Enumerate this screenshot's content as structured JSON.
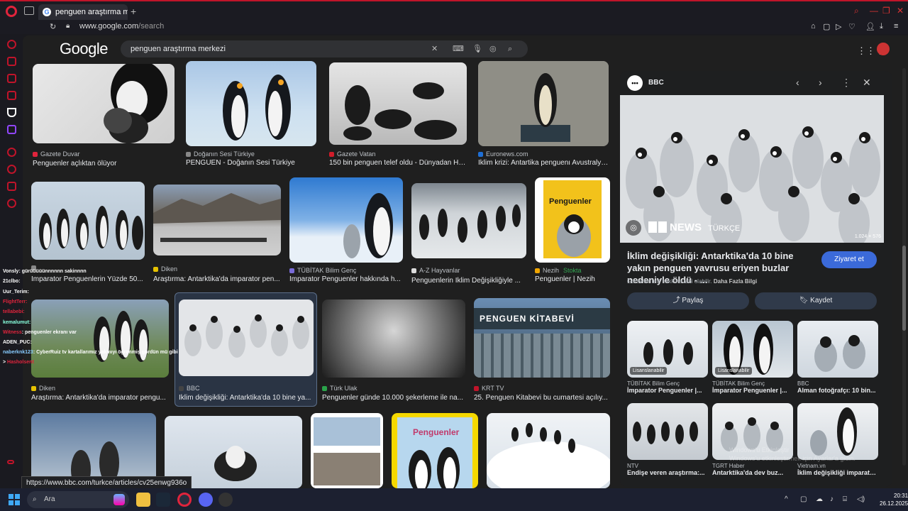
{
  "browser": {
    "tab_title": "penguen araştırma merkez",
    "url_host": "www.google.com",
    "url_path": "/search",
    "status_url": "https://www.bbc.com/turkce/articles/cv25enwg936o"
  },
  "google": {
    "logo": "Google",
    "query": "penguen araştırma merkezi"
  },
  "results": [
    {
      "source": "Gazete Duvar",
      "title": "Penguenler açlıktan ölüyor",
      "color": "#e0243c"
    },
    {
      "source": "Doğanın Sesi Türkiye",
      "title": "PENGUEN - Doğanın Sesi Türkiye",
      "color": "#888888"
    },
    {
      "source": "Gazete Vatan",
      "title": "150 bin penguen telef oldu - Dünyadan Ha...",
      "color": "#d01c2a"
    },
    {
      "source": "Euronews.com",
      "title": "İklim krizi: Antartika penguenı Avustralya...",
      "color": "#1e6fd6"
    },
    {
      "source": "",
      "title": "İmparator Penguenlerin Yüzde 50...",
      "color": "#888888"
    },
    {
      "source": "Diken",
      "title": "Araştırma: Antarktika'da imparator pen...",
      "color": "#e6c200"
    },
    {
      "source": "TÜBİTAK Bilim Genç",
      "title": "İmparator Penguenler hakkında h...",
      "color": "#7a6cd9"
    },
    {
      "source": "A-Z Hayvanlar",
      "title": "Penguenlerin İklim Değişikliğiyle ...",
      "color": "#dddddd"
    },
    {
      "source": "Nezih",
      "stock": "Stokta",
      "title": "Penguenler | Nezih",
      "color": "#f0a500"
    },
    {
      "source": "Diken",
      "title": "Araştırma: Antarktika'da imparator pengu...",
      "color": "#e6c200"
    },
    {
      "source": "BBC",
      "title": "İklim değişikliği: Antarktika'da 10 bine ya...",
      "color": "#444444"
    },
    {
      "source": "Türk Ulak",
      "title": "Penguenler günde 10.000 şekerleme ile na...",
      "color": "#2aa34a"
    },
    {
      "source": "KRT TV",
      "title": "25. Penguen Kitabevi bu cumartesi açılıy...",
      "color": "#c0142a"
    }
  ],
  "bookcovers": {
    "book1": "Penguenler",
    "book2": "Penguenler",
    "store": "PENGUEN KİTABEVİ"
  },
  "panel": {
    "source": "BBC",
    "source_icon": "•••",
    "watermark": "NEWS",
    "watermark_lang": "TÜRKÇE",
    "dimensions": "1.024 × 576",
    "title": "İklim değişikliği: Antarktika'da 10 bine yakın penguen yavrusu eriyen buzlar nedeniyle öldü - ...",
    "visit": "Ziyaret et",
    "note": "Görseller telif hakkına tabi olabilir.",
    "more": "Daha Fazla Bilgi",
    "share": "Paylaş",
    "save": "Kaydet",
    "related": [
      {
        "source": "TÜBİTAK Bilim Genç",
        "title": "İmparator Penguenler |...",
        "badge": "Lisanslanabilir"
      },
      {
        "source": "TÜBİTAK Bilim Genç",
        "title": "İmparator Penguenler |...",
        "badge": "Lisanslanabilir"
      },
      {
        "source": "BBC",
        "title": "Alman fotoğrafçı: 10 bin...",
        "badge": ""
      },
      {
        "source": "NTV",
        "title": "Endişe veren araştırma:...",
        "badge": ""
      },
      {
        "source": "TGRT Haber",
        "title": "Antarktika'da dev buz...",
        "badge": ""
      },
      {
        "source": "Vietnam.vn",
        "title": "İklim değişikliği imparator...",
        "badge": ""
      }
    ]
  },
  "chat": [
    {
      "user": "Vonsly",
      "msg": ": gürüüüüünnnnnn sakinnnn",
      "color": "#ffffff"
    },
    {
      "user": "21clbo",
      "msg": ":",
      "color": "#ffffff"
    },
    {
      "user": "Uur_Terim",
      "msg": ":",
      "color": "#ffffff"
    },
    {
      "user": "FlightTerr",
      "msg": ":",
      "color": "#e0243c"
    },
    {
      "user": "tellabebi",
      "msg": ":",
      "color": "#e0243c"
    },
    {
      "user": "kemalumut",
      "msg": ":",
      "color": "#8fd"
    },
    {
      "user": "Witness",
      "msg": ": penguenler ekranı var",
      "color": "#e0243c"
    },
    {
      "user": "ADEN_PUC",
      "msg": ":",
      "color": "#ffffff"
    },
    {
      "user": "naberknk123",
      "msg": ": CyberRuiz tv kartallarımız yakmıyı öğrenmiş gördün mü gibi",
      "color": "#8cf"
    },
    {
      "user": ">",
      "msg": " Hasholsent",
      "color": "#e0243c"
    }
  ],
  "windows": {
    "activate_line1": "Windows'u Etkinleştir",
    "activate_line2": "Windows'u etkinleştirmek için Ayarlar'a gidin.",
    "search": "Ara",
    "time": "20:31",
    "date": "26.12.2025"
  }
}
